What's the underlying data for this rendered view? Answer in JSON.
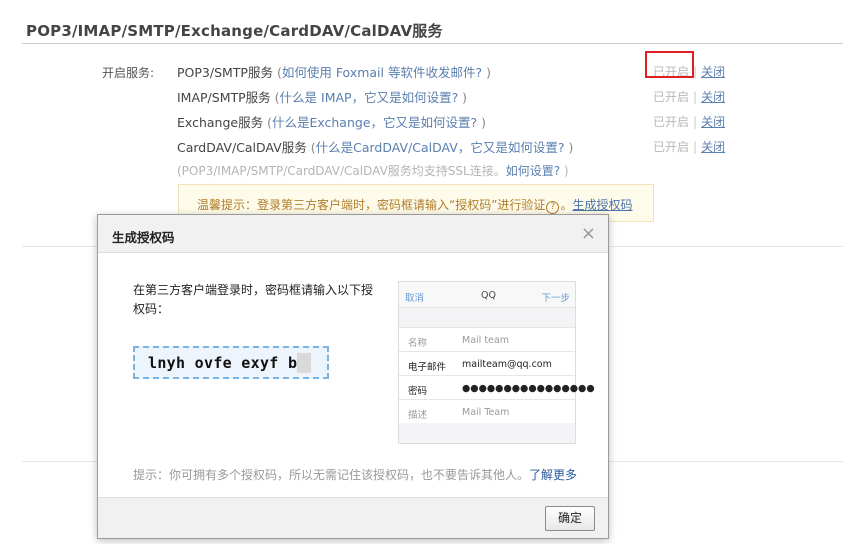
{
  "section": {
    "title": "POP3/IMAP/SMTP/Exchange/CardDAV/CalDAV服务"
  },
  "services": {
    "label": "开启服务:",
    "rows": [
      {
        "name": "POP3/SMTP服务",
        "open": " (",
        "link": "如何使用 Foxmail 等软件收发邮件?",
        "close": " )",
        "status_on": "已开启",
        "sep": "|",
        "status_off": "关闭"
      },
      {
        "name": "IMAP/SMTP服务",
        "open": " (",
        "link": "什么是 IMAP，它又是如何设置?",
        "close": " )",
        "status_on": "已开启",
        "sep": "|",
        "status_off": "关闭"
      },
      {
        "name": "Exchange服务",
        "open": " (",
        "link": "什么是Exchange，它又是如何设置?",
        "close": " )",
        "status_on": "已开启",
        "sep": "|",
        "status_off": "关闭"
      },
      {
        "name": "CardDAV/CalDAV服务",
        "open": " (",
        "link": "什么是CardDAV/CalDAV，它又是如何设置?",
        "close": " )",
        "status_on": "已开启",
        "sep": "|",
        "status_off": "关闭"
      }
    ],
    "ssl_note_pre": "(POP3/IMAP/SMTP/CardDAV/CalDAV服务均支持SSL连接。",
    "ssl_note_link": "如何设置?",
    "ssl_note_post": " )"
  },
  "tip": {
    "text_pre": "温馨提示：登录第三方客户端时，密码框请输入“授权码”进行验证",
    "qmark": "?",
    "text_post": "。",
    "link": "生成授权码"
  },
  "modal": {
    "title": "生成授权码",
    "close_glyph": "×",
    "instruction": "在第三方客户端登录时，密码框请输入以下授权码：",
    "auth_code": "lnyh ovfe exyf be",
    "phone": {
      "cancel": "取消",
      "title": "QQ",
      "next": "下一步",
      "rows": [
        {
          "key": "名称",
          "value": "Mail team"
        },
        {
          "key": "电子邮件",
          "value": "mailteam@qq.com"
        },
        {
          "key": "密码",
          "value": "●●●●●●●●●●●●●●●●"
        },
        {
          "key": "描述",
          "value": "Mail Team"
        }
      ]
    },
    "hint_text": "提示：你可拥有多个授权码，所以无需记住该授权码，也不要告诉其他人。",
    "hint_link": "了解更多",
    "ok_label": "确定"
  },
  "colors": {
    "link": "#5b7fae",
    "highlight_border": "#e02020",
    "tip_bg": "#fffbea",
    "code_border": "#7ab3e6"
  }
}
